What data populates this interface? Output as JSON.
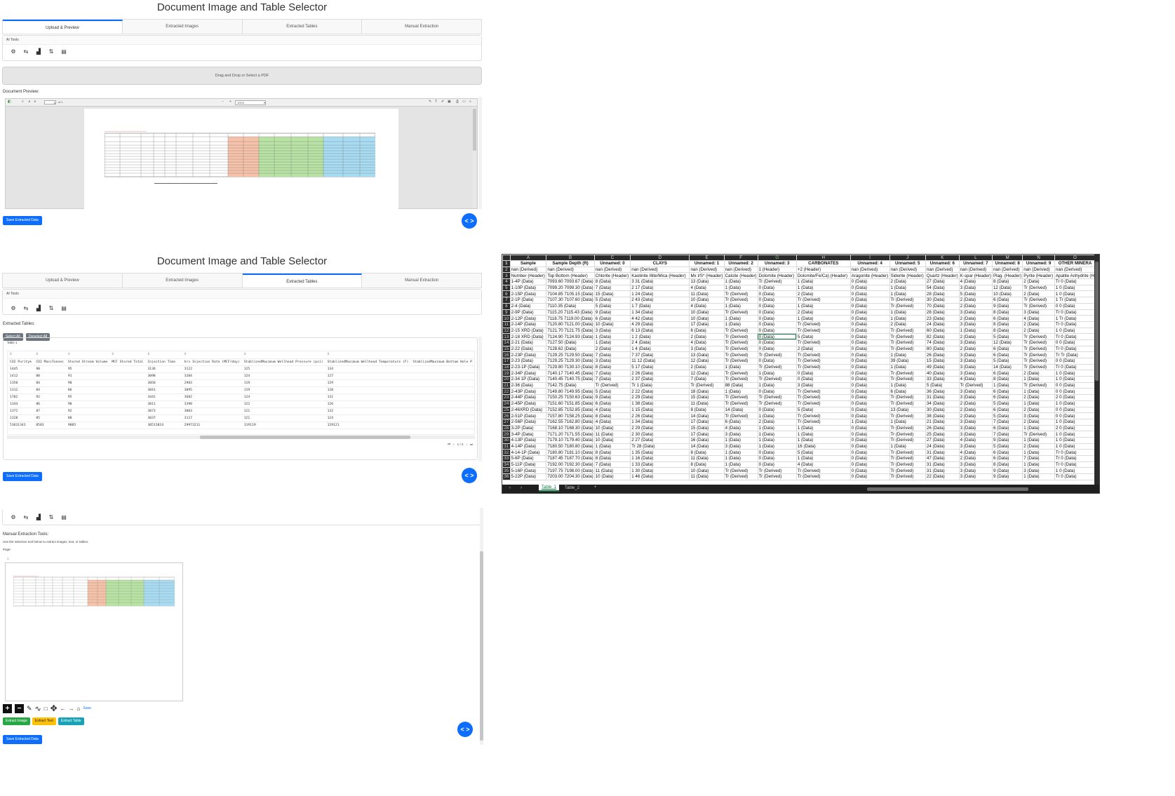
{
  "app_title": "Document Image and Table Selector",
  "tabs": [
    "Upload & Preview",
    "Extracted Images",
    "Extracted Tables",
    "Manual Extraction"
  ],
  "ai_tools_label": "AI Tools",
  "toolbar_icons": [
    "gear-icon",
    "swap-icon",
    "chart-icon",
    "sort-icon",
    "document-icon"
  ],
  "upload": {
    "dropzone": "Drag and Drop or Select a PDF",
    "preview_label": "Document Preview:",
    "page_field": "1",
    "page_of": "of 1",
    "zoom": "100%"
  },
  "save_button": "Save Extracted Data",
  "code_toggle": "< >",
  "tables_panel": {
    "label": "Extracted Tables:",
    "select_all": "Select All",
    "deselect_all": "Deselect All",
    "table_name": "Table 1",
    "header_nums": [
      "0",
      "0",
      "0",
      "0",
      "0",
      "0",
      "0",
      "0"
    ],
    "columns": [
      "CO2 Purity%",
      "CO2 MassTonnes",
      "Stored Stream Volume",
      "MCF Stored Total",
      "Injection Time",
      "hrs Injection Rate (MCF/day)",
      "StablizedMaximum Wellhead Pressure (psi)",
      "StablizedMaximum Wellhead Temperature (F)",
      "StablizedMaximum Bottom Hole P"
    ],
    "rows": [
      [
        "1445",
        "90",
        "95",
        "3136",
        "3122",
        "125",
        "134"
      ],
      [
        "1412",
        "88",
        "91",
        "3098",
        "3204",
        "124",
        "127"
      ],
      [
        "1350",
        "84",
        "90",
        "3058",
        "2983",
        "119",
        "129"
      ],
      [
        "1312",
        "84",
        "86",
        "3041",
        "3095",
        "119",
        "120"
      ],
      [
        "1702",
        "92",
        "95",
        "3442",
        "3682",
        "124",
        "131"
      ],
      [
        "1344",
        "86",
        "90",
        "3011",
        "3390",
        "122",
        "126"
      ],
      [
        "1372",
        "87",
        "92",
        "3073",
        "3003",
        "121",
        "132"
      ],
      [
        "1328",
        "85",
        "88",
        "3037",
        "3117",
        "121",
        "124"
      ],
      [
        "53631343",
        "8583",
        "9085",
        "30513824",
        "29973211",
        "119119",
        "129121"
      ]
    ],
    "pager": "1 / 2"
  },
  "manual": {
    "title": "Manual Extraction Tools:",
    "help": "Use the selection tool below to extract images, text, or tables.",
    "page_label": "Page:",
    "page_num": "1",
    "save_link": "Save",
    "extract_image": "Extract Image",
    "extract_text": "Extract Text",
    "extract_table": "Extract Table"
  },
  "excel": {
    "col_letters": [
      "A",
      "B",
      "C",
      "D",
      "E",
      "F",
      "G",
      "H",
      "I",
      "J",
      "K",
      "L",
      "M",
      "N",
      "O"
    ],
    "header": [
      "Sample",
      "Sample Depth (ft)",
      "Unnamed: 0",
      "CLAYS",
      "Unnamed: 1",
      "Unnamed: 2",
      "Unnamed: 3",
      "CARBONATES",
      "Unnamed: 4",
      "Unnamed: 5",
      "Unnamed: 6",
      "Unnamed: 7",
      "Unnamed: 8",
      "Unnamed: 9",
      "OTHER MINERA"
    ],
    "rows": [
      [
        "nan (Derived)",
        "nan (Derived)",
        "nan (Derived)",
        "nan (Derived)",
        "nan (Derived)",
        "nan (Derived)",
        "1 (Header)",
        "+2 (Header)",
        "nan (Derived)",
        "nan (Derived)",
        "nan (Derived)",
        "nan (Derived)",
        "nan (Derived)",
        "nan (Derived)",
        "nan (Derived)"
      ],
      [
        "Number (Header)",
        "Top Bottom (Header)",
        "Chlorite (Header)",
        "Kaolinite Illite/Mica (Header)",
        "Mx I/S* (Header)",
        "Calcite (Header)",
        "Dolomite (Header)",
        "Dolomite/Fe/Ca) (Header)",
        "Aragonite (Header)",
        "Siderite (Header)",
        "Quartz (Header)",
        "K-spar (Header)",
        "Plag. (Header)",
        "Pyrite (Header)",
        "Apatite Anhydrite (H"
      ],
      [
        "1-4P (Data)",
        "7093.60 7093.67 (Data)",
        "8 (Data)",
        "3 31 (Data)",
        "13 (Data)",
        "1 (Data)",
        "Tr (Derived)",
        "1 (Data)",
        "0 (Data)",
        "2 (Data)",
        "27 (Data)",
        "4 (Data)",
        "8 (Data)",
        "2 (Data)",
        "Tr 0 (Data)"
      ],
      [
        "1-10P (Data)",
        "7099.20 7099.30 (Data)",
        "7 (Data)",
        "2 17 (Data)",
        "4 (Data)",
        "1 (Data)",
        "0 (Data)",
        "1 (Data)",
        "0 (Data)",
        "1 (Data)",
        "54 (Data)",
        "3 (Data)",
        "12 (Data)",
        "Tr (Derived)",
        "1 0 (Data)"
      ],
      [
        "2-15P (Data)",
        "7104.85 7105.15 (Data)",
        "15 (Data)",
        "1 24 (Data)",
        "11 (Data)",
        "Tr (Derived)",
        "0 (Data)",
        "2 (Data)",
        "0 (Data)",
        "1 (Data)",
        "28 (Data)",
        "5 (Data)",
        "10 (Data)",
        "2 (Data)",
        "1 0 (Data)"
      ],
      [
        "2-1P (Data)",
        "7107.30 7107.60 (Data)",
        "5 (Data)",
        "2 43 (Data)",
        "10 (Data)",
        "Tr (Derived)",
        "0 (Data)",
        "Tr (Derived)",
        "0 (Data)",
        "Tr (Derived)",
        "30 (Data)",
        "2 (Data)",
        "6 (Data)",
        "Tr (Derived)",
        "1 Tr (Data)"
      ],
      [
        "2-4 (Data)",
        "7110.35 (Data)",
        "5 (Data)",
        "1 7 (Data)",
        "4 (Data)",
        "1 (Data)",
        "0 (Data)",
        "1 (Data)",
        "0 (Data)",
        "Tr (Derived)",
        "70 (Data)",
        "2 (Data)",
        "9 (Data)",
        "Tr (Derived)",
        "0 0 (Data)"
      ],
      [
        "2-9P (Data)",
        "7115.20 7115.43 (Data)",
        "9 (Data)",
        "1 34 (Data)",
        "10 (Data)",
        "Tr (Derived)",
        "0 (Data)",
        "2 (Data)",
        "0 (Data)",
        "1 (Data)",
        "28 (Data)",
        "3 (Data)",
        "8 (Data)",
        "3 (Data)",
        "Tr 0 (Data)"
      ],
      [
        "2-12P (Data)",
        "7118.75 7119.00 (Data)",
        "6 (Data)",
        "4 42 (Data)",
        "10 (Data)",
        "1 (Data)",
        "0 (Data)",
        "1 (Data)",
        "0 (Data)",
        "1 (Data)",
        "23 (Data)",
        "2 (Data)",
        "6 (Data)",
        "4 (Data)",
        "1 Tr (Data)"
      ],
      [
        "2-14P (Data)",
        "7120.80 7121.00 (Data)",
        "10 (Data)",
        "4 29 (Data)",
        "17 (Data)",
        "1 (Data)",
        "0 (Data)",
        "Tr (Derived)",
        "0 (Data)",
        "2 (Data)",
        "24 (Data)",
        "3 (Data)",
        "8 (Data)",
        "2 (Data)",
        "Tr 0 (Data)"
      ],
      [
        "2-15 XRD (Data)",
        "7121.70 7121.75 (Data)",
        "3 (Data)",
        "6 13 (Data)",
        "6 (Data)",
        "Tr (Derived)",
        "0 (Data)",
        "Tr (Derived)",
        "0 (Data)",
        "Tr (Derived)",
        "60 (Data)",
        "1 (Data)",
        "8 (Data)",
        "2 (Data)",
        "1 0 (Data)"
      ],
      [
        "2-18 XRD (Data)",
        "7124.90 7124.93 (Data)",
        "1 (Data)",
        "1 2 (Data)",
        "2 (Data)",
        "Tr (Derived)",
        "0 (Data)",
        "5 (Data)",
        "0 (Data)",
        "Tr (Derived)",
        "82 (Data)",
        "2 (Data)",
        "5 (Data)",
        "Tr (Derived)",
        "Tr 0 (Data)"
      ],
      [
        "2-21 (Data)",
        "7127.50 (Data)",
        "1 (Data)",
        "2 4 (Data)",
        "4 (Data)",
        "Tr (Derived)",
        "0 (Data)",
        "Tr (Derived)",
        "0 (Data)",
        "Tr (Derived)",
        "74 (Data)",
        "3 (Data)",
        "12 (Data)",
        "Tr (Derived)",
        "0 0 (Data)"
      ],
      [
        "2-22 (Data)",
        "7128.62 (Data)",
        "2 (Data)",
        "1 4 (Data)",
        "3 (Data)",
        "Tr (Derived)",
        "0 (Data)",
        "2 (Data)",
        "0 (Data)",
        "Tr (Derived)",
        "80 (Data)",
        "2 (Data)",
        "6 (Data)",
        "Tr (Derived)",
        "Tr 0 (Data)"
      ],
      [
        "2-23P (Data)",
        "7129.25 7129.50 (Data)",
        "7 (Data)",
        "7 37 (Data)",
        "13 (Data)",
        "Tr (Derived)",
        "Tr (Derived)",
        "Tr (Derived)",
        "0 (Data)",
        "1 (Data)",
        "26 (Data)",
        "3 (Data)",
        "6 (Data)",
        "Tr (Derived)",
        "Tr Tr (Data)"
      ],
      [
        "2-23 (Data)",
        "7129.25 7129.30 (Data)",
        "3 (Data)",
        "11 12 (Data)",
        "12 (Data)",
        "Tr (Derived)",
        "0 (Data)",
        "Tr (Derived)",
        "0 (Data)",
        "39 (Data)",
        "15 (Data)",
        "3 (Data)",
        "5 (Data)",
        "Tr (Derived)",
        "0 0 (Data)"
      ],
      [
        "2-23-1P (Data)",
        "7129.80 7130.10 (Data)",
        "8 (Data)",
        "5 17 (Data)",
        "2 (Data)",
        "1 (Data)",
        "Tr (Derived)",
        "Tr (Derived)",
        "0 (Data)",
        "1 (Data)",
        "49 (Data)",
        "3 (Data)",
        "14 (Data)",
        "Tr (Derived)",
        "Tr 0 (Data)"
      ],
      [
        "2-34P (Data)",
        "7140.17 7140.45 (Data)",
        "7 (Data)",
        "2 26 (Data)",
        "12 (Data)",
        "Tr (Derived)",
        "1 (Data)",
        "0 (Data)",
        "0 (Data)",
        "Tr (Derived)",
        "40 (Data)",
        "3 (Data)",
        "6 (Data)",
        "2 (Data)",
        "1 0 (Data)"
      ],
      [
        "2-34 1P (Data)",
        "7140.45 7140.75 (Data)",
        "7 (Data)",
        "2 37 (Data)",
        "7 (Data)",
        "Tr (Derived)",
        "Tr (Derived)",
        "0 (Data)",
        "0 (Data)",
        "Tr (Derived)",
        "33 (Data)",
        "4 (Data)",
        "8 (Data)",
        "1 (Data)",
        "1 0 (Data)"
      ],
      [
        "2-36 (Data)",
        "7142.75 (Data)",
        "Tr (Derived)",
        "Tr 1 (Data)",
        "Tr (Derived)",
        "88 (Data)",
        "1 (Data)",
        "3 (Data)",
        "0 (Data)",
        "1 (Data)",
        "5 (Data)",
        "Tr (Derived)",
        "1 (Data)",
        "Tr (Derived)",
        "0 0 (Data)"
      ],
      [
        "2-43P (Data)",
        "7149.80 7149.95 (Data)",
        "5 (Data)",
        "2 22 (Data)",
        "18 (Data)",
        "1 (Data)",
        "0 (Data)",
        "Tr (Derived)",
        "0 (Data)",
        "6 (Data)",
        "36 (Data)",
        "3 (Data)",
        "6 (Data)",
        "1 (Data)",
        "0 0 (Data)"
      ],
      [
        "2-44P (Data)",
        "7150.25 7150.63 (Data)",
        "9 (Data)",
        "2 29 (Data)",
        "15 (Data)",
        "Tr (Derived)",
        "Tr (Derived)",
        "Tr (Derived)",
        "0 (Data)",
        "Tr (Derived)",
        "31 (Data)",
        "3 (Data)",
        "6 (Data)",
        "2 (Data)",
        "2 0 (Data)"
      ],
      [
        "2-45P (Data)",
        "7151.60 7151.85 (Data)",
        "6 (Data)",
        "1 38 (Data)",
        "11 (Data)",
        "Tr (Derived)",
        "Tr (Derived)",
        "Tr (Derived)",
        "0 (Data)",
        "Tr (Derived)",
        "34 (Data)",
        "2 (Data)",
        "5 (Data)",
        "1 (Data)",
        "1 0 (Data)"
      ],
      [
        "2-46XRD (Data)",
        "7152.85 7152.85 (Data)",
        "4 (Data)",
        "1 15 (Data)",
        "8 (Data)",
        "14 (Data)",
        "0 (Data)",
        "5 (Data)",
        "0 (Data)",
        "13 (Data)",
        "30 (Data)",
        "2 (Data)",
        "6 (Data)",
        "2 (Data)",
        "0 0 (Data)"
      ],
      [
        "2-51P (Data)",
        "7157.80 7158.25 (Data)",
        "8 (Data)",
        "2 26 (Data)",
        "14 (Data)",
        "Tr (Derived)",
        "1 (Data)",
        "Tr (Derived)",
        "0 (Data)",
        "Tr (Derived)",
        "38 (Data)",
        "2 (Data)",
        "5 (Data)",
        "3 (Data)",
        "0 0 (Data)"
      ],
      [
        "2-56P (Data)",
        "7162.55 7162.80 (Data)",
        "4 (Data)",
        "1 34 (Data)",
        "17 (Data)",
        "6 (Data)",
        "2 (Data)",
        "Tr (Derived)",
        "1 (Data)",
        "1 (Data)",
        "21 (Data)",
        "3 (Data)",
        "7 (Data)",
        "2 (Data)",
        "1 0 (Data)"
      ],
      [
        "3-2P (Data)",
        "7168.10 7168.30 (Data)",
        "10 (Data)",
        "2 29 (Data)",
        "15 (Data)",
        "4 (Data)",
        "1 (Data)",
        "1 (Data)",
        "0 (Data)",
        "Tr (Derived)",
        "26 (Data)",
        "3 (Data)",
        "6 (Data)",
        "1 (Data)",
        "2 0 (Data)"
      ],
      [
        "3-4P (Data)",
        "7171.20 7171.55 (Data)",
        "11 (Data)",
        "2 30 (Data)",
        "17 (Data)",
        "3 (Data)",
        "1 (Data)",
        "1 (Data)",
        "0 (Data)",
        "Tr (Derived)",
        "25 (Data)",
        "3 (Data)",
        "7 (Data)",
        "Tr (Derived)",
        "1 0 (Data)"
      ],
      [
        "4-13P (Data)",
        "7179.10 7179.40 (Data)",
        "10 (Data)",
        "2 27 (Data)",
        "16 (Data)",
        "1 (Data)",
        "1 (Data)",
        "1 (Data)",
        "0 (Data)",
        "Tr (Derived)",
        "27 (Data)",
        "4 (Data)",
        "9 (Data)",
        "1 (Data)",
        "1 0 (Data)"
      ],
      [
        "4-14P (Data)",
        "7180.50 7180.80 (Data)",
        "1 (Data)",
        "Tr 28 (Data)",
        "14 (Data)",
        "3 (Data)",
        "1 (Data)",
        "16 (Data)",
        "0 (Data)",
        "1 (Data)",
        "24 (Data)",
        "3 (Data)",
        "5 (Data)",
        "2 (Data)",
        "1 0 (Data)"
      ],
      [
        "4-14-1P (Data)",
        "7180.80 7181.10 (Data)",
        "8 (Data)",
        "1 35 (Data)",
        "8 (Data)",
        "1 (Data)",
        "0 (Data)",
        "5 (Data)",
        "0 (Data)",
        "Tr (Derived)",
        "31 (Data)",
        "4 (Data)",
        "6 (Data)",
        "1 (Data)",
        "Tr 0 (Data)"
      ],
      [
        "5-6P (Data)",
        "7187.45 7187.70 (Data)",
        "8 (Data)",
        "1 16 (Data)",
        "11 (Data)",
        "1 (Data)",
        "0 (Data)",
        "1 (Data)",
        "0 (Data)",
        "Tr (Derived)",
        "47 (Data)",
        "2 (Data)",
        "6 (Data)",
        "7 (Data)",
        "Tr 0 (Data)"
      ],
      [
        "5-11P (Data)",
        "7192.00 7192.30 (Data)",
        "7 (Data)",
        "1 33 (Data)",
        "8 (Data)",
        "1 (Data)",
        "0 (Data)",
        "4 (Data)",
        "0 (Data)",
        "Tr (Derived)",
        "31 (Data)",
        "3 (Data)",
        "8 (Data)",
        "1 (Data)",
        "Tr 0 (Data)"
      ],
      [
        "5-16P (Data)",
        "7197.75 7198.00 (Data)",
        "11 (Data)",
        "1 30 (Data)",
        "10 (Data)",
        "Tr (Derived)",
        "Tr (Derived)",
        "Tr (Derived)",
        "0 (Data)",
        "Tr (Derived)",
        "31 (Data)",
        "3 (Data)",
        "9 (Data)",
        "3 (Data)",
        "1 0 (Data)"
      ],
      [
        "5-22P (Data)",
        "7203.00 7204.30 (Data)",
        "10 (Data)",
        "1 46 (Data)",
        "11 (Data)",
        "Tr (Derived)",
        "Tr (Derived)",
        "Tr (Derived)",
        "0 (Data)",
        "Tr (Derived)",
        "22 (Data)",
        "3 (Data)",
        "9 (Data)",
        "1 (Data)",
        "Tr 0 (Data)"
      ]
    ],
    "sheet_tabs": [
      "Table_1",
      "Table_2"
    ],
    "add_sheet": "+"
  }
}
